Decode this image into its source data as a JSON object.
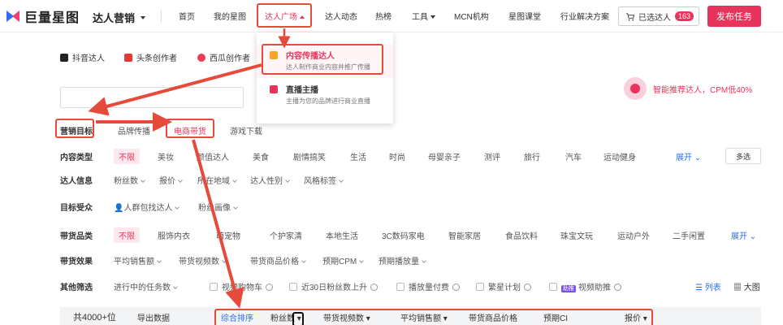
{
  "header": {
    "logo_text": "巨量星图",
    "brand": "达人营销",
    "nav": [
      "首页",
      "我的星图",
      "达人广场",
      "达人动态",
      "热榜",
      "工具",
      "MCN机构",
      "星图课堂",
      "行业解决方案"
    ],
    "selected_label": "已选达人",
    "selected_count": "163",
    "publish": "发布任务"
  },
  "dropdown": {
    "items": [
      {
        "title": "内容传播达人",
        "sub": "达人制作商业内容并推广传播"
      },
      {
        "title": "直播主播",
        "sub": "主播为您的品牌进行商业直播"
      }
    ]
  },
  "platforms": [
    "抖音达人",
    "头条创作者",
    "西瓜创作者"
  ],
  "promo": "智能推荐达人，CPM低40%",
  "goals": {
    "label": "营销目标",
    "options": [
      "品牌传播",
      "电商带货",
      "游戏下载"
    ]
  },
  "content_type": {
    "label": "内容类型",
    "options": [
      "不限",
      "美妆",
      "颜值达人",
      "美食",
      "剧情搞笑",
      "生活",
      "时尚",
      "母婴亲子",
      "测评",
      "旅行",
      "汽车",
      "运动健身"
    ],
    "expand": "展开",
    "multi": "多选"
  },
  "talent_info": {
    "label": "达人信息",
    "options": [
      "粉丝数",
      "报价",
      "所在地域",
      "达人性别",
      "风格标签"
    ]
  },
  "audience": {
    "label": "目标受众",
    "options": [
      "人群包找达人",
      "粉丝画像"
    ]
  },
  "goods_category": {
    "label": "带货品类",
    "options": [
      "不限",
      "服饰内衣",
      "萌宠物",
      "个护家清",
      "本地生活",
      "3C数码家电",
      "智能家居",
      "食品饮料",
      "珠宝文玩",
      "运动户外",
      "二手闲置"
    ],
    "expand": "展开"
  },
  "goods_effect": {
    "label": "带货效果",
    "options": [
      "平均销售额",
      "带货视频数",
      "带货商品价格",
      "预期CPM",
      "预期播放量"
    ]
  },
  "other": {
    "label": "其他筛选",
    "options": [
      "进行中的任务数",
      "视频购物车",
      "近30日粉丝数上升",
      "播放量付费",
      "繁星计划",
      "视频助推"
    ],
    "boost_tag": "助推",
    "list_view": "列表",
    "grid_view": "大图"
  },
  "results": {
    "count": "共4000+位",
    "export": "导出数据",
    "sorts": [
      "综合排序",
      "粉丝数",
      "带货视频数",
      "平均销售额",
      "带货商品价格",
      "预期CI",
      "报价"
    ]
  }
}
